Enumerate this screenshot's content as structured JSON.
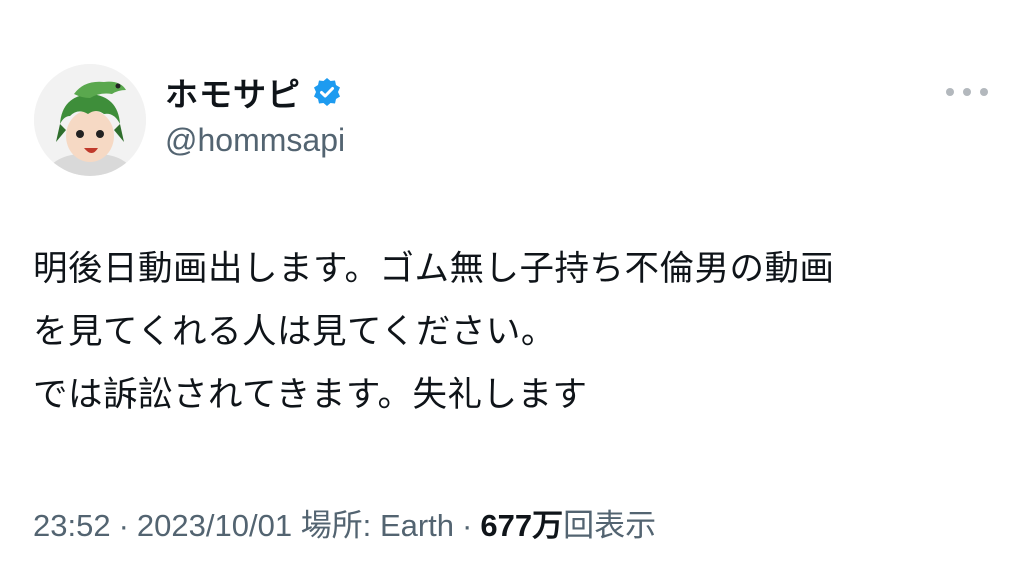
{
  "author": {
    "display_name": "ホモサピ",
    "handle": "@hommsapi",
    "verified_icon": "verified-badge-icon",
    "avatar": "avatar-illustration"
  },
  "more_icon": "more-horizontal-icon",
  "tweet": {
    "lines": [
      "明後日動画出します。ゴム無し子持ち不倫男の動画",
      "を見てくれる人は見てください。",
      "では訴訟されてきます。失礼します"
    ]
  },
  "meta": {
    "time": "23:52",
    "date": "2023/10/01",
    "location_label": "場所:",
    "location": "Earth",
    "views_count": "677万",
    "views_label": "回表示"
  },
  "colors": {
    "text": "#0f1419",
    "secondary": "#536471",
    "verified": "#1d9bf0"
  }
}
